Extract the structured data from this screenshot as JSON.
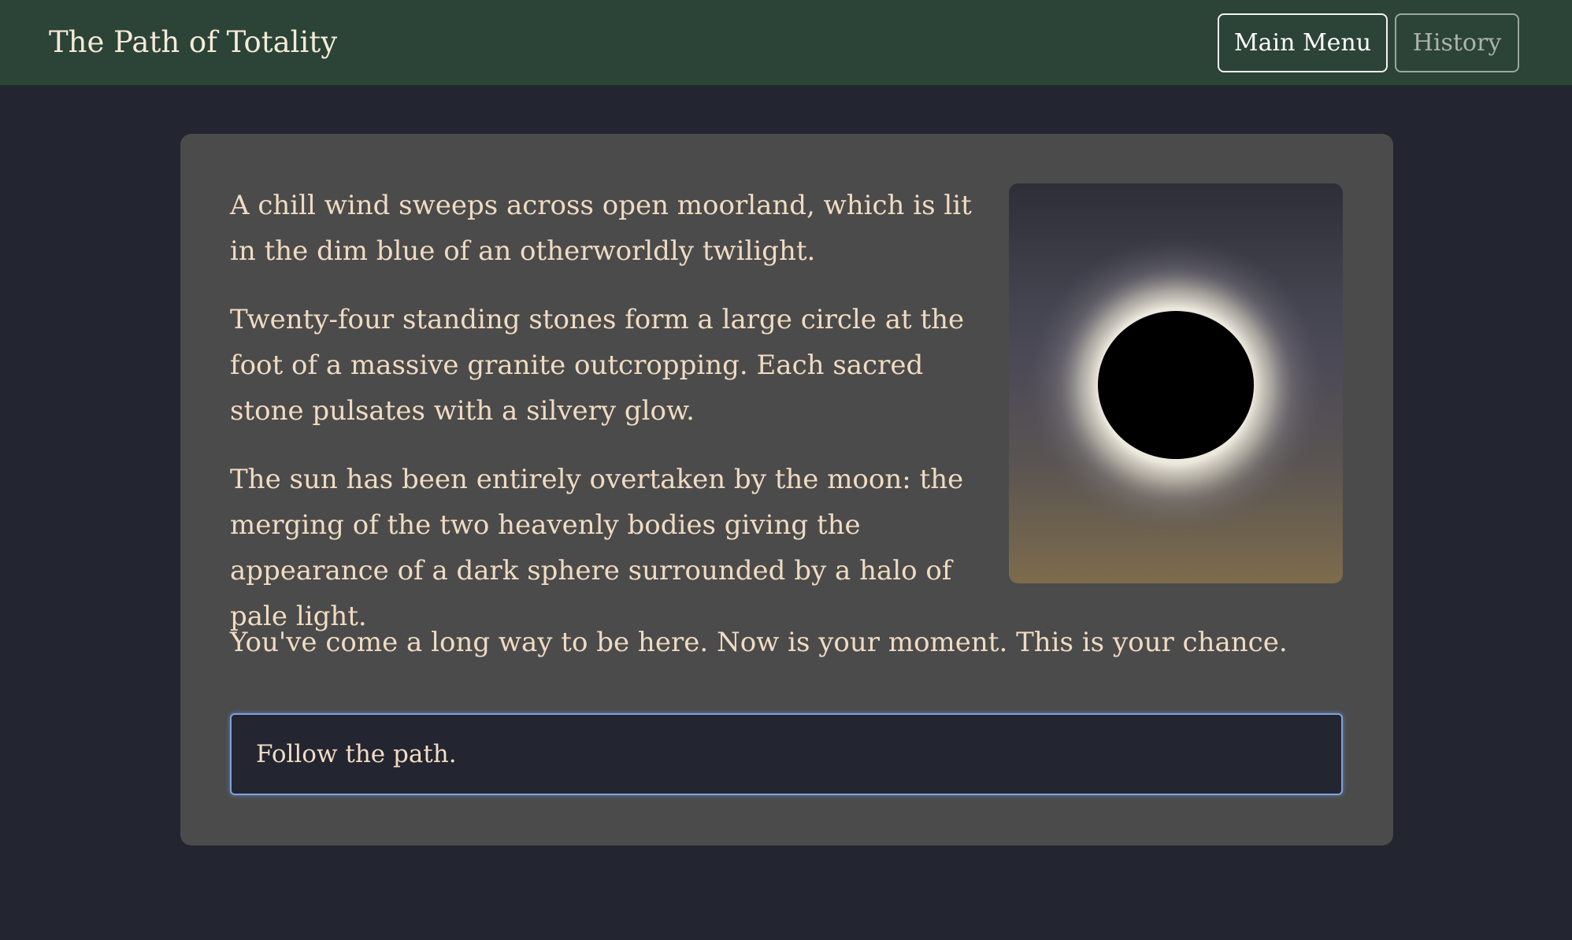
{
  "header": {
    "title": "The Path of Totality",
    "buttons": {
      "main_menu": "Main Menu",
      "history": "History"
    }
  },
  "passage": {
    "paragraphs": [
      "A chill wind sweeps across open moorland, which is lit in the dim blue of an otherworldly twilight.",
      "Twenty-four standing stones form a large circle at the foot of a massive granite outcropping. Each sacred stone pulsates with a silvery glow.",
      "The sun has been entirely overtaken by the moon: the merging of the two heavenly bodies giving the appearance of a dark sphere surrounded by a halo of pale light."
    ],
    "closing": "You've come a long way to be here. Now is your moment. This is your chance.",
    "image": "solar-eclipse-illustration"
  },
  "choices": [
    {
      "label": "Follow the path."
    }
  ],
  "colors": {
    "header_bg": "#2c4337",
    "page_bg": "#232530",
    "card_bg": "#4b4b4b",
    "text": "#f0dbc2",
    "focus_ring": "#7fa1de"
  }
}
